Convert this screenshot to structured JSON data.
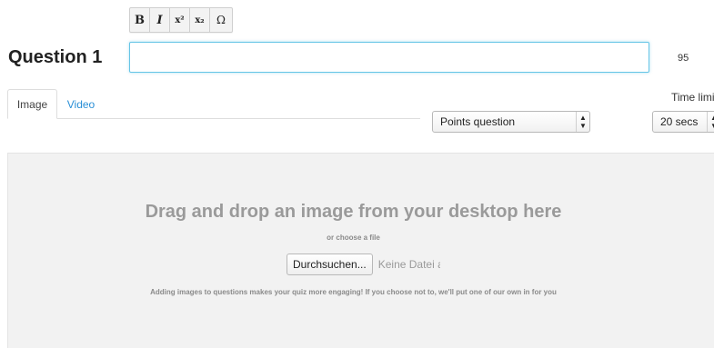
{
  "toolbar": {
    "buttons": [
      {
        "label": "B",
        "name": "bold"
      },
      {
        "label": "I",
        "name": "italic"
      },
      {
        "label": "x²",
        "name": "superscript"
      },
      {
        "label": "x₂",
        "name": "subscript"
      },
      {
        "label": "Ω",
        "name": "special-characters"
      }
    ]
  },
  "question": {
    "label": "Question 1",
    "value": "",
    "char_count": "95"
  },
  "tabs": [
    {
      "label": "Image",
      "active": true
    },
    {
      "label": "Video",
      "active": false
    }
  ],
  "points": {
    "selected": "Points question"
  },
  "time_limit": {
    "label": "Time limit",
    "selected": "20 secs"
  },
  "dropzone": {
    "title": "Drag and drop an image from your desktop here",
    "choose_text": "or choose a file",
    "browse_label": "Durchsuchen...",
    "file_status": "Keine Datei ausgewählt.",
    "note": "Adding images to questions makes your quiz more engaging! If you choose not to, we'll put one of our own in for you"
  },
  "colors": {
    "accent_link": "#2a8fd6",
    "input_focus_border": "#66c5e6",
    "dropzone_bg": "#f2f2f2"
  }
}
